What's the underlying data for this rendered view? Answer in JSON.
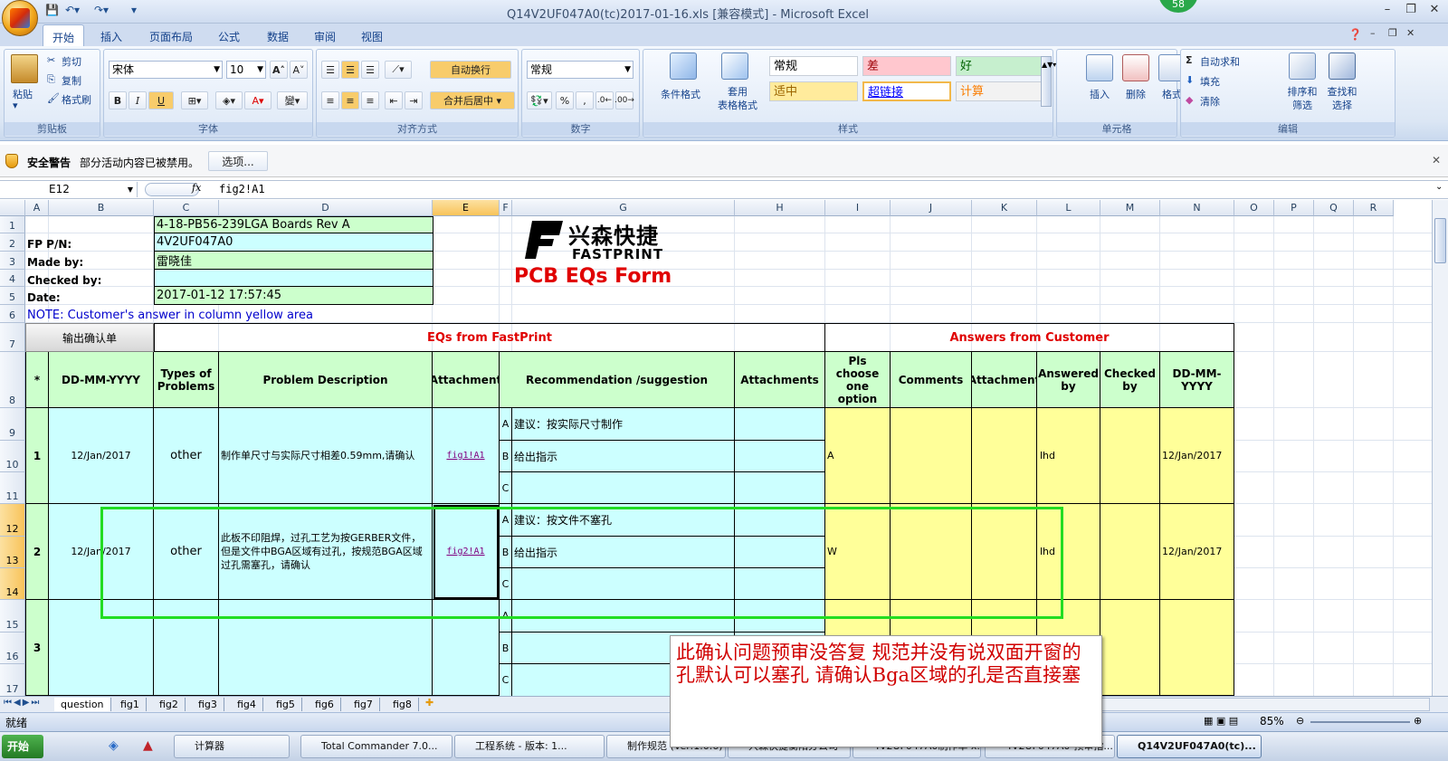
{
  "window": {
    "title": "Q14V2UF047A0(tc)2017-01-16.xls  [兼容模式] - Microsoft Excel",
    "badge": "58"
  },
  "tabs": [
    "开始",
    "插入",
    "页面布局",
    "公式",
    "数据",
    "审阅",
    "视图"
  ],
  "ribbon": {
    "clipboard": {
      "label": "剪贴板",
      "paste": "粘贴",
      "cut": "剪切",
      "copy": "复制",
      "format_painter": "格式刷"
    },
    "font": {
      "label": "字体",
      "font_name": "宋体",
      "font_size": "10",
      "bold": "B",
      "italic": "I",
      "underline": "U"
    },
    "alignment": {
      "label": "对齐方式",
      "wrap": "自动换行",
      "merge": "合并后居中"
    },
    "number": {
      "label": "数字",
      "format": "常规",
      "percent": "%"
    },
    "styles": {
      "label": "样式",
      "conditional": "条件格式",
      "table": "套用\n表格格式",
      "cells": [
        {
          "text": "常规",
          "bg": "#ffffff",
          "color": "#000000"
        },
        {
          "text": "差",
          "bg": "#ffc7ce",
          "color": "#9c0006"
        },
        {
          "text": "好",
          "bg": "#c6efce",
          "color": "#006100"
        },
        {
          "text": "适中",
          "bg": "#ffeb9c",
          "color": "#9c6500"
        },
        {
          "text": "超链接",
          "bg": "#ffffff",
          "color": "#0000ff"
        },
        {
          "text": "计算",
          "bg": "#f2f2f2",
          "color": "#fa7d00"
        }
      ]
    },
    "cells_group": {
      "label": "单元格",
      "insert": "插入",
      "delete": "删除",
      "format": "格式"
    },
    "editing": {
      "label": "编辑",
      "autosum": "自动求和",
      "fill": "填充",
      "clear": "清除",
      "sort": "排序和\n筛选",
      "find": "查找和\n选择"
    }
  },
  "security": {
    "title": "安全警告",
    "message": "部分活动内容已被禁用。",
    "button": "选项..."
  },
  "formula_bar": {
    "name_box": "E12",
    "fx": "fx",
    "formula": "fig2!A1"
  },
  "columns": [
    "A",
    "B",
    "C",
    "D",
    "E",
    "F",
    "G",
    "H",
    "I",
    "J",
    "K",
    "L",
    "M",
    "N",
    "O",
    "P",
    "Q",
    "R"
  ],
  "rows": [
    "1",
    "2",
    "3",
    "4",
    "5",
    "6",
    "7",
    "8",
    "9",
    "10",
    "11",
    "12",
    "13",
    "14",
    "15",
    "16",
    "17"
  ],
  "sheet": {
    "labels": {
      "fp_pn": "FP P/N:",
      "made_by": "Made by:",
      "checked_by": "Checked by:",
      "date": "Date:"
    },
    "header_values": {
      "row1": "4-18-PB56-239LGA Boards Rev A",
      "fp_pn": "4V2UF047A0",
      "made_by": "雷晓佳",
      "checked_by": "",
      "date": "2017-01-12 17:57:45"
    },
    "logo": {
      "cn": "兴森快捷",
      "en": "FASTPRINT",
      "form_title": "PCB EQs Form"
    },
    "note": "NOTE: Customer's  answer in column yellow area",
    "confirm_button": "输出确认单",
    "section_eqs": "EQs from FastPrint",
    "section_answers": "Answers from Customer",
    "col_headers": {
      "star": "*",
      "date": "DD-MM-YYYY",
      "types": "Types of Problems",
      "problem": "Problem Description",
      "attachment": "Attachment",
      "recommendation": "Recommendation /suggestion",
      "attachments": "Attachments",
      "choose": "Pls choose one option",
      "comments": "Comments",
      "attachment2": "Attachment",
      "answered": "Answered by",
      "checked": "Checked by",
      "date2": "DD-MM-YYYY"
    },
    "items": [
      {
        "no": "1",
        "date": "12/Jan/2017",
        "type": "other",
        "problem": "制作单尺寸与实际尺寸相差0.59mm,请确认",
        "attachment": "fig1!A1",
        "options": [
          {
            "k": "A",
            "v": "建议：按实际尺寸制作"
          },
          {
            "k": "B",
            "v": "给出指示"
          },
          {
            "k": "C",
            "v": ""
          }
        ],
        "choice": "A",
        "answered": "lhd",
        "date2": "12/Jan/2017"
      },
      {
        "no": "2",
        "date": "12/Jan/2017",
        "type": "other",
        "problem": "此板不印阻焊，过孔工艺为按GERBER文件，但是文件中BGA区域有过孔，按规范BGA区域过孔需塞孔，请确认",
        "attachment": "fig2!A1",
        "options": [
          {
            "k": "A",
            "v": "建议：按文件不塞孔"
          },
          {
            "k": "B",
            "v": "给出指示"
          },
          {
            "k": "C",
            "v": ""
          }
        ],
        "choice": "W",
        "answered": "lhd",
        "date2": "12/Jan/2017"
      },
      {
        "no": "3",
        "date": "",
        "type": "",
        "problem": "",
        "attachment": "",
        "options": [
          {
            "k": "A",
            "v": ""
          },
          {
            "k": "B",
            "v": ""
          },
          {
            "k": "C",
            "v": ""
          }
        ],
        "choice": "",
        "answered": "",
        "date2": ""
      }
    ]
  },
  "callout": "此确认问题预审没答复   规范并没有说双面开窗的孔默认可以塞孔   请确认Bga区域的孔是否直接塞",
  "sheet_tabs": [
    "question",
    "fig1",
    "fig2",
    "fig3",
    "fig4",
    "fig5",
    "fig6",
    "fig7",
    "fig8"
  ],
  "status": {
    "ready": "就绪",
    "zoom": "85%"
  },
  "taskbar": {
    "start": "开始",
    "items": [
      "计算器",
      "Total Commander 7.0...",
      "工程系统 - 版本: 1...",
      "制作规范 (Ver:1.0.6)",
      "兴森快捷衡阳分公司",
      "4V2UF047A0制作单 x...",
      "4V2UF047A0-预审指...",
      "Q14V2UF047A0(tc)..."
    ]
  }
}
